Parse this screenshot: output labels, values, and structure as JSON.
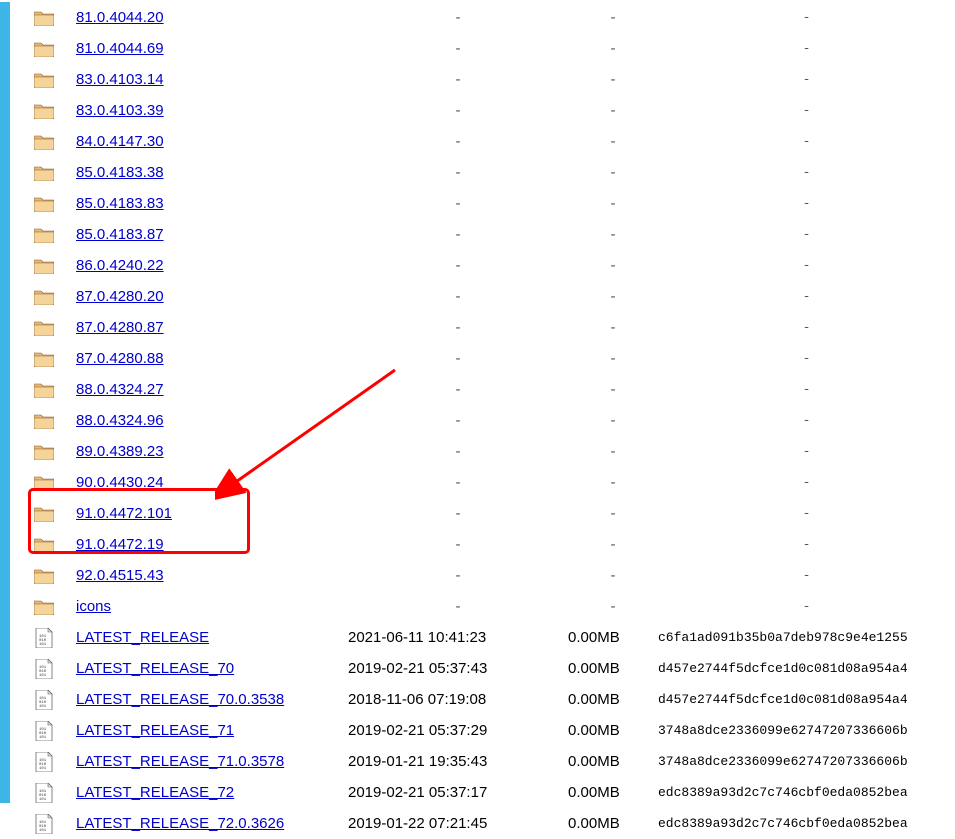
{
  "rows": [
    {
      "type": "folder",
      "name": "81.0.4044.20",
      "date": "-",
      "size": "-",
      "hash": "-"
    },
    {
      "type": "folder",
      "name": "81.0.4044.69",
      "date": "-",
      "size": "-",
      "hash": "-"
    },
    {
      "type": "folder",
      "name": "83.0.4103.14",
      "date": "-",
      "size": "-",
      "hash": "-"
    },
    {
      "type": "folder",
      "name": "83.0.4103.39",
      "date": "-",
      "size": "-",
      "hash": "-"
    },
    {
      "type": "folder",
      "name": "84.0.4147.30",
      "date": "-",
      "size": "-",
      "hash": "-"
    },
    {
      "type": "folder",
      "name": "85.0.4183.38",
      "date": "-",
      "size": "-",
      "hash": "-"
    },
    {
      "type": "folder",
      "name": "85.0.4183.83",
      "date": "-",
      "size": "-",
      "hash": "-"
    },
    {
      "type": "folder",
      "name": "85.0.4183.87",
      "date": "-",
      "size": "-",
      "hash": "-"
    },
    {
      "type": "folder",
      "name": "86.0.4240.22",
      "date": "-",
      "size": "-",
      "hash": "-"
    },
    {
      "type": "folder",
      "name": "87.0.4280.20",
      "date": "-",
      "size": "-",
      "hash": "-"
    },
    {
      "type": "folder",
      "name": "87.0.4280.87",
      "date": "-",
      "size": "-",
      "hash": "-"
    },
    {
      "type": "folder",
      "name": "87.0.4280.88",
      "date": "-",
      "size": "-",
      "hash": "-"
    },
    {
      "type": "folder",
      "name": "88.0.4324.27",
      "date": "-",
      "size": "-",
      "hash": "-"
    },
    {
      "type": "folder",
      "name": "88.0.4324.96",
      "date": "-",
      "size": "-",
      "hash": "-"
    },
    {
      "type": "folder",
      "name": "89.0.4389.23",
      "date": "-",
      "size": "-",
      "hash": "-"
    },
    {
      "type": "folder",
      "name": "90.0.4430.24",
      "date": "-",
      "size": "-",
      "hash": "-"
    },
    {
      "type": "folder",
      "name": "91.0.4472.101",
      "date": "-",
      "size": "-",
      "hash": "-"
    },
    {
      "type": "folder",
      "name": "91.0.4472.19",
      "date": "-",
      "size": "-",
      "hash": "-"
    },
    {
      "type": "folder",
      "name": "92.0.4515.43",
      "date": "-",
      "size": "-",
      "hash": "-"
    },
    {
      "type": "folder",
      "name": "icons",
      "date": "-",
      "size": "-",
      "hash": "-"
    },
    {
      "type": "file",
      "name": "LATEST_RELEASE",
      "date": "2021-06-11 10:41:23",
      "size": "0.00MB",
      "hash": "c6fa1ad091b35b0a7deb978c9e4e1255"
    },
    {
      "type": "file",
      "name": "LATEST_RELEASE_70",
      "date": "2019-02-21 05:37:43",
      "size": "0.00MB",
      "hash": "d457e2744f5dcfce1d0c081d08a954a4"
    },
    {
      "type": "file",
      "name": "LATEST_RELEASE_70.0.3538",
      "date": "2018-11-06 07:19:08",
      "size": "0.00MB",
      "hash": "d457e2744f5dcfce1d0c081d08a954a4"
    },
    {
      "type": "file",
      "name": "LATEST_RELEASE_71",
      "date": "2019-02-21 05:37:29",
      "size": "0.00MB",
      "hash": "3748a8dce2336099e62747207336606b"
    },
    {
      "type": "file",
      "name": "LATEST_RELEASE_71.0.3578",
      "date": "2019-01-21 19:35:43",
      "size": "0.00MB",
      "hash": "3748a8dce2336099e62747207336606b"
    },
    {
      "type": "file",
      "name": "LATEST_RELEASE_72",
      "date": "2019-02-21 05:37:17",
      "size": "0.00MB",
      "hash": "edc8389a93d2c7c746cbf0eda0852bea"
    },
    {
      "type": "file",
      "name": "LATEST_RELEASE_72.0.3626",
      "date": "2019-01-22 07:21:45",
      "size": "0.00MB",
      "hash": "edc8389a93d2c7c746cbf0eda0852bea"
    }
  ],
  "watermark": ""
}
